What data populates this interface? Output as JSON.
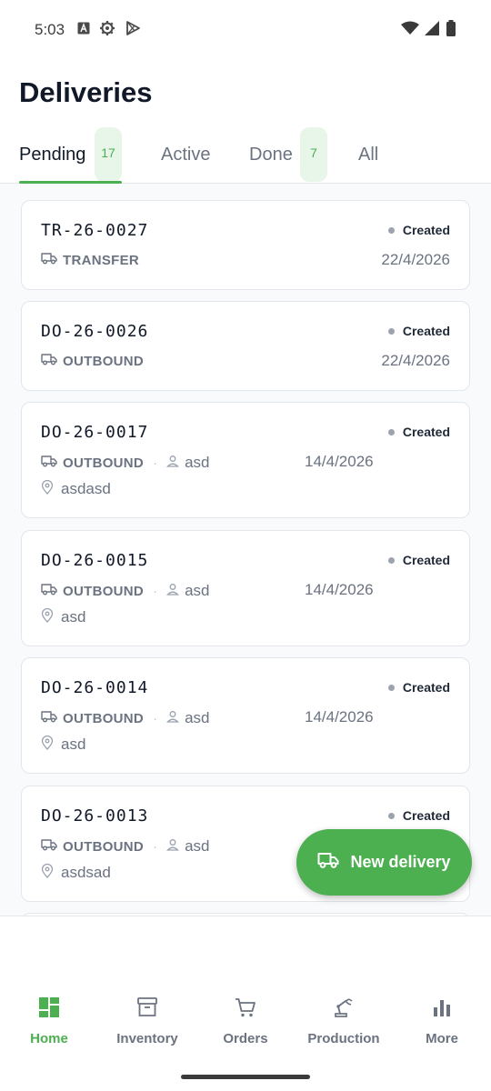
{
  "status_bar": {
    "time": "5:03",
    "left_icons": [
      "notification-a-icon",
      "settings-gear-icon",
      "play-store-icon"
    ],
    "right_icons": [
      "wifi-icon",
      "cell-signal-icon",
      "battery-icon"
    ]
  },
  "page": {
    "title": "Deliveries"
  },
  "tabs": [
    {
      "label": "Pending",
      "badge": "17",
      "active": true
    },
    {
      "label": "Active",
      "badge": "",
      "active": false
    },
    {
      "label": "Done",
      "badge": "7",
      "active": false
    },
    {
      "label": "All",
      "badge": "",
      "active": false
    }
  ],
  "deliveries": [
    {
      "code": "TR-26-0027",
      "status": "Created",
      "type": "TRANSFER",
      "person": "",
      "date": "22/4/2026",
      "location": ""
    },
    {
      "code": "DO-26-0026",
      "status": "Created",
      "type": "OUTBOUND",
      "person": "",
      "date": "22/4/2026",
      "location": ""
    },
    {
      "code": "DO-26-0017",
      "status": "Created",
      "type": "OUTBOUND",
      "person": "asd",
      "date": "14/4/2026",
      "location": "asdasd"
    },
    {
      "code": "DO-26-0015",
      "status": "Created",
      "type": "OUTBOUND",
      "person": "asd",
      "date": "14/4/2026",
      "location": "asd"
    },
    {
      "code": "DO-26-0014",
      "status": "Created",
      "type": "OUTBOUND",
      "person": "asd",
      "date": "14/4/2026",
      "location": "asd"
    },
    {
      "code": "DO-26-0013",
      "status": "Created",
      "type": "OUTBOUND",
      "person": "asd",
      "date": "",
      "location": "asdsad"
    }
  ],
  "fab": {
    "label": "New delivery",
    "icon": "truck-icon"
  },
  "bottom_nav": [
    {
      "label": "Home",
      "icon": "dashboard-icon",
      "active": true
    },
    {
      "label": "Inventory",
      "icon": "archive-box-icon",
      "active": false
    },
    {
      "label": "Orders",
      "icon": "shopping-cart-icon",
      "active": false
    },
    {
      "label": "Production",
      "icon": "robot-arm-icon",
      "active": false
    },
    {
      "label": "More",
      "icon": "bar-chart-icon",
      "active": false
    }
  ],
  "colors": {
    "accent": "#4caf50",
    "badge_bg": "#e8f5e9",
    "text_primary": "#111827",
    "text_secondary": "#6b7280",
    "status_dot": "#9ca3af"
  }
}
